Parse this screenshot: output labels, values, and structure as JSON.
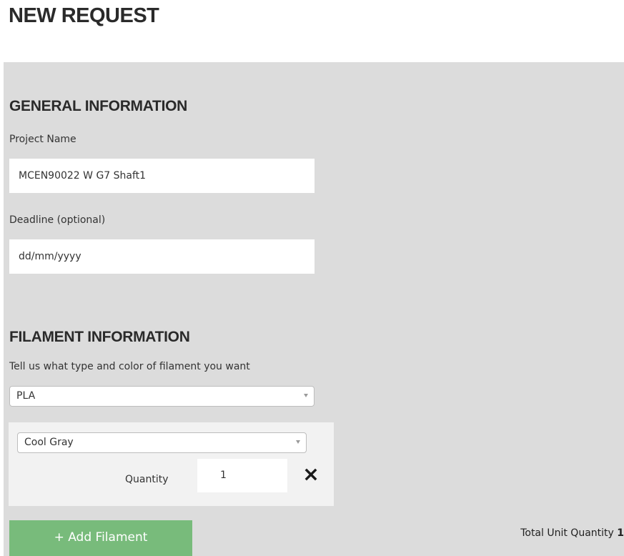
{
  "header": {
    "title": "NEW REQUEST"
  },
  "general": {
    "heading": "GENERAL INFORMATION",
    "project_name_label": "Project Name",
    "project_name_value": "MCEN90022 W G7 Shaft1",
    "deadline_label": "Deadline (optional)",
    "deadline_placeholder": "dd/mm/yyyy"
  },
  "filament": {
    "heading": "FILAMENT INFORMATION",
    "description": "Tell us what type and color of filament you want",
    "type_selected": "PLA",
    "items": [
      {
        "color_selected": "Cool Gray",
        "quantity_label": "Quantity",
        "quantity_value": "1",
        "remove_icon": "close-icon"
      }
    ],
    "add_button_label": "+ Add Filament",
    "total_label": "Total Unit Quantity",
    "total_value": "1"
  },
  "colors": {
    "panel_bg": "#dcdcdc",
    "item_bg": "#f2f2f2",
    "add_button_bg": "#78bb7b"
  }
}
